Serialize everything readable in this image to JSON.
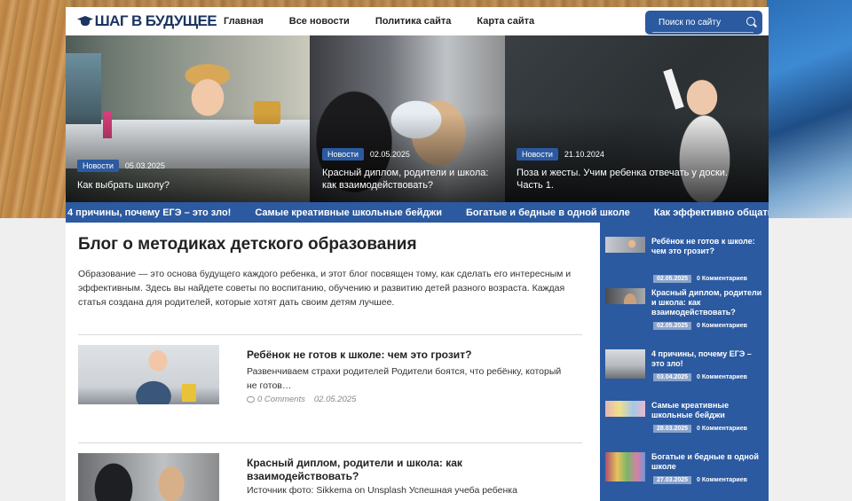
{
  "header": {
    "logo_text": "ШАГ В БУДУЩЕЕ",
    "nav": [
      "Главная",
      "Все новости",
      "Политика сайта",
      "Карта сайта"
    ],
    "search_placeholder": "Поиск по сайту"
  },
  "slider": [
    {
      "category": "Новости",
      "date": "05.03.2025",
      "title": "Как выбрать школу?"
    },
    {
      "category": "Новости",
      "date": "02.05.2025",
      "title": "Красный диплом, родители и школа: как взаимодействовать?"
    },
    {
      "category": "Новости",
      "date": "21.10.2024",
      "title": "Поза и жесты. Учим ребенка отвечать у доски. Часть 1."
    }
  ],
  "ticker": [
    "4 причины, почему ЕГЭ – это зло!",
    "Самые креативные школьные бейджи",
    "Богатые и бедные в одной школе",
    "Как эффективно общаться с педаго"
  ],
  "main": {
    "heading": "Блог о методиках детского образования",
    "intro": "Образование — это основа будущего каждого ребенка, и этот блог посвящен тому, как сделать его интересным и эффективным. Здесь вы найдете советы по воспитанию, обучению и развитию детей разного возраста. Каждая статья создана для родителей, которые хотят дать своим детям лучшее.",
    "posts": [
      {
        "title": "Ребёнок не готов к школе: чем это грозит?",
        "excerpt": "Развенчиваем страхи родителей Родители боятся, что ребёнку, который не готов…",
        "comments": "0 Comments",
        "date": "02.05.2025"
      },
      {
        "title": "Красный диплом, родители и школа: как взаимодействовать?",
        "excerpt": "Источник фото: Sikkema on Unsplash Успешная учеба ребенка"
      }
    ]
  },
  "sidebar": [
    {
      "title": "Ребёнок не готов к школе: чем это грозит?",
      "date": "02.05.2025",
      "comments": "0 Комментариев"
    },
    {
      "title": "Красный диплом, родители и школа: как взаимодействовать?",
      "date": "02.05.2025",
      "comments": "0 Комментариев"
    },
    {
      "title": "4 причины, почему ЕГЭ – это зло!",
      "date": "03.04.2025",
      "comments": "0 Комментариев"
    },
    {
      "title": "Самые креативные школьные бейджи",
      "date": "28.03.2025",
      "comments": "0 Комментариев"
    },
    {
      "title": "Богатые и бедные в одной школе",
      "date": "27.03.2025",
      "comments": "0 Комментариев"
    }
  ],
  "colors": {
    "accent": "#2c5aa0",
    "logo": "#1c3560"
  }
}
